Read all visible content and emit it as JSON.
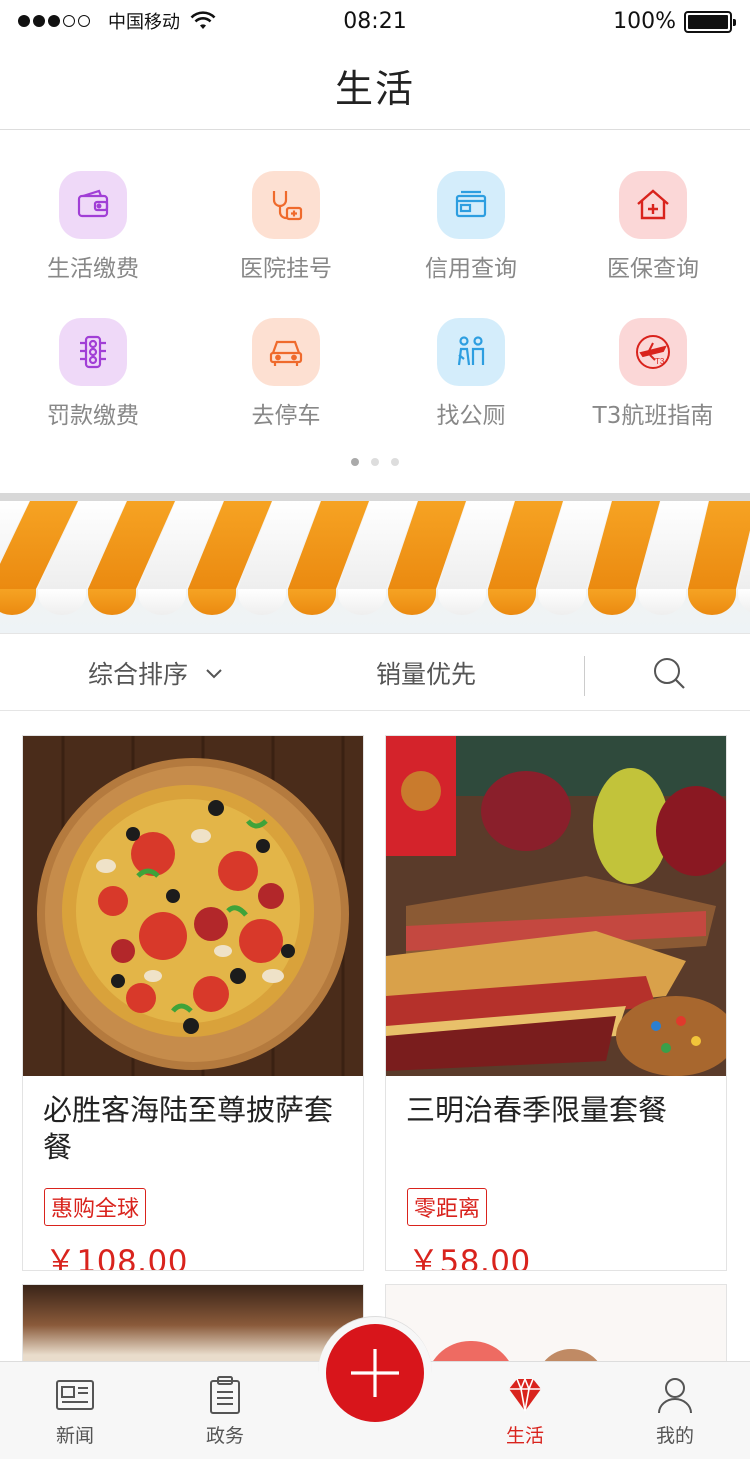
{
  "status_bar": {
    "carrier": "中国移动",
    "time": "08:21",
    "battery": "100%"
  },
  "nav": {
    "title": "生活"
  },
  "services": [
    {
      "label": "生活缴费",
      "icon": "wallet-icon",
      "bg": "#efd9f8",
      "fg": "#a13fd6"
    },
    {
      "label": "医院挂号",
      "icon": "stethoscope-icon",
      "bg": "#fde0d2",
      "fg": "#ef6a2c"
    },
    {
      "label": "信用查询",
      "icon": "credit-card-icon",
      "bg": "#d4edfb",
      "fg": "#2d9ee0"
    },
    {
      "label": "医保查询",
      "icon": "medical-house-icon",
      "bg": "#fbd7d7",
      "fg": "#d9231d"
    },
    {
      "label": "罚款缴费",
      "icon": "traffic-light-icon",
      "bg": "#efd9f8",
      "fg": "#a13fd6"
    },
    {
      "label": "去停车",
      "icon": "car-icon",
      "bg": "#fde0d2",
      "fg": "#ef6a2c"
    },
    {
      "label": "找公厕",
      "icon": "restroom-icon",
      "bg": "#d4edfb",
      "fg": "#2d9ee0"
    },
    {
      "label": "T3航班指南",
      "icon": "airplane-icon",
      "bg": "#fbd7d7",
      "fg": "#d9231d"
    }
  ],
  "filters": {
    "sort_label": "综合排序",
    "sales_label": "销量优先"
  },
  "products": [
    {
      "title": "必胜客海陆至尊披萨套餐",
      "tag": "惠购全球",
      "price": "￥108.00",
      "image": "pizza-image"
    },
    {
      "title": "三明治春季限量套餐",
      "tag": "零距离",
      "price": "￥58.00",
      "image": "sandwich-image"
    }
  ],
  "tabs": [
    {
      "label": "新闻",
      "icon": "news-icon"
    },
    {
      "label": "政务",
      "icon": "clipboard-icon"
    },
    {
      "label": "生活",
      "icon": "diamond-icon",
      "active": true
    },
    {
      "label": "我的",
      "icon": "profile-icon"
    }
  ],
  "colors": {
    "accent": "#d9231d",
    "awning_orange": "#f39a1e"
  }
}
